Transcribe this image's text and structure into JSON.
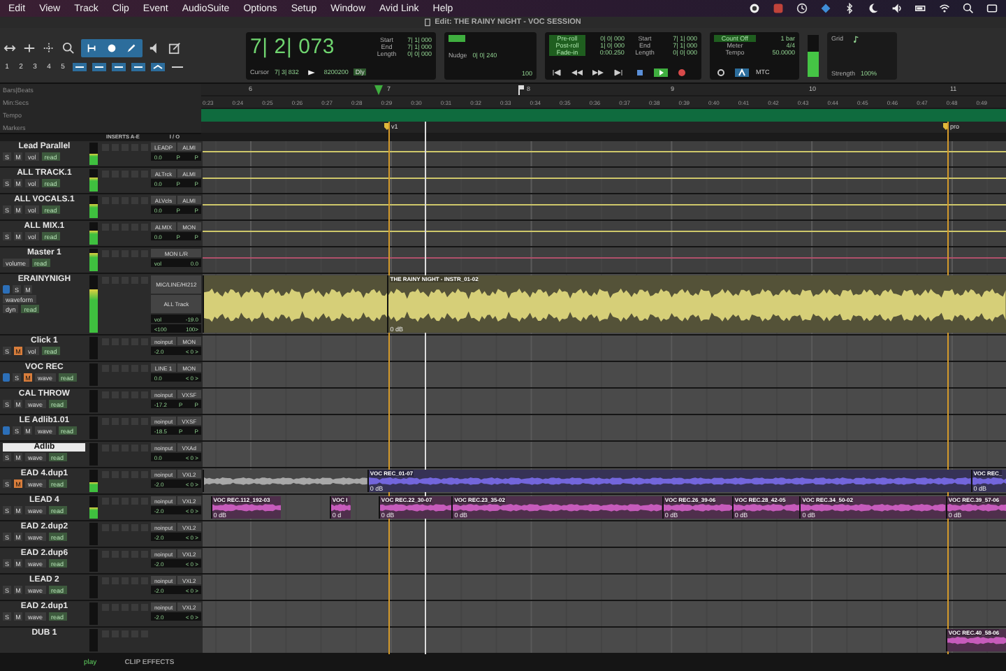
{
  "menu_bar": {
    "items": [
      "Edit",
      "View",
      "Track",
      "Clip",
      "Event",
      "AudioSuite",
      "Options",
      "Setup",
      "Window",
      "Avid Link",
      "Help"
    ]
  },
  "window": {
    "title": "Edit: THE RAINY NIGHT - VOC SESSION"
  },
  "toolbar": {
    "zoom_presets": [
      "1",
      "2",
      "3",
      "4",
      "5"
    ],
    "main_counter": "7| 2| 073",
    "selection": [
      {
        "label": "Start",
        "value": "7| 1| 000"
      },
      {
        "label": "End",
        "value": "7| 1| 000"
      },
      {
        "label": "Length",
        "value": "0| 0| 000"
      }
    ],
    "sub_counter": {
      "label": "Cursor",
      "value": "7| 3| 832",
      "samples": "8200200",
      "delay": "Dly"
    },
    "nudge": {
      "label": "Nudge",
      "value": "0| 0| 240",
      "sub_value": "100"
    },
    "transport": {
      "rows": [
        {
          "label": "Pre-roll",
          "value": "0| 0| 000"
        },
        {
          "label": "Post-roll",
          "value": "1| 0| 000"
        },
        {
          "label": "Fade-in",
          "value": "0:00.250"
        }
      ],
      "selection": [
        {
          "label": "Start",
          "value": "7| 1| 000"
        },
        {
          "label": "End",
          "value": "7| 1| 000"
        },
        {
          "label": "Length",
          "value": "0| 0| 000"
        }
      ]
    },
    "midi": {
      "count_off": "Count Off",
      "count_value": "1 bar",
      "meter_label": "Meter",
      "meter": "4/4",
      "tempo_label": "Tempo",
      "tempo": "50.0000",
      "sync": "MTC"
    },
    "output_meter": {
      "level": 0.6
    },
    "grid": {
      "label": "Grid",
      "strength_label": "Strength",
      "strength": "100%"
    }
  },
  "rulers": {
    "labels": [
      "Bars|Beats",
      "Min:Secs",
      "Tempo",
      "Markers"
    ],
    "bars": [
      "6",
      "7",
      "8",
      "9",
      "10",
      "11"
    ],
    "times": [
      "0:23",
      "0:24",
      "0:25",
      "0:26",
      "0:27",
      "0:28",
      "0:29",
      "0:30",
      "0:31",
      "0:32",
      "0:33",
      "0:34",
      "0:35",
      "0:36",
      "0:37",
      "0:38",
      "0:39",
      "0:40",
      "0:41",
      "0:42",
      "0:43",
      "0:44",
      "0:45",
      "0:46",
      "0:47",
      "0:48",
      "0:49"
    ],
    "markers": [
      "v1",
      "pro"
    ]
  },
  "track_columns": [
    "INSERTS A-E",
    "I / O"
  ],
  "tracks": [
    {
      "name": "Lead Parallel",
      "kind": "aux",
      "buttons": [
        {
          "kind": "solo",
          "label": "S",
          "on": false
        },
        {
          "kind": "mute",
          "label": "M",
          "on": false
        }
      ],
      "view": "vol",
      "automation": "read",
      "meter": {
        "level": 0.5
      },
      "input": "LEADP",
      "output": "ALMI",
      "volume": "0.0",
      "pan": [
        "P",
        "P"
      ]
    },
    {
      "name": "ALL TRACK.1",
      "kind": "aux",
      "buttons": [
        {
          "kind": "solo",
          "label": "S",
          "on": false
        },
        {
          "kind": "mute",
          "label": "M",
          "on": false
        }
      ],
      "view": "vol",
      "automation": "read",
      "meter": {
        "level": 0.6
      },
      "input": "ALTrck",
      "output": "ALMI",
      "volume": "0.0",
      "pan": [
        "P",
        "P"
      ]
    },
    {
      "name": "ALL VOCALS.1",
      "kind": "aux",
      "buttons": [
        {
          "kind": "solo",
          "label": "S",
          "on": false
        },
        {
          "kind": "mute",
          "label": "M",
          "on": false
        }
      ],
      "view": "vol",
      "automation": "read",
      "meter": {
        "level": 0.6
      },
      "input": "ALVcls",
      "output": "ALMI",
      "volume": "0.0",
      "pan": [
        "P",
        "P"
      ]
    },
    {
      "name": "ALL MIX.1",
      "kind": "aux",
      "buttons": [
        {
          "kind": "solo",
          "label": "S",
          "on": false
        },
        {
          "kind": "mute",
          "label": "M",
          "on": false
        }
      ],
      "view": "vol",
      "automation": "read",
      "meter": {
        "level": 0.6
      },
      "input": "ALMIX",
      "output": "MON",
      "volume": "0.0",
      "pan": [
        "P",
        "P"
      ]
    },
    {
      "name": "Master 1",
      "kind": "master",
      "view": "volume",
      "automation": "read",
      "meter": {
        "level": 0.8
      },
      "output": "MON L/R",
      "volume_label": "vol",
      "volume": "0.0"
    },
    {
      "name": "ERAINYNIGH",
      "kind": "instrument",
      "input_monitor": true,
      "buttons": [
        {
          "kind": "solo",
          "label": "S",
          "on": false
        },
        {
          "kind": "mute",
          "label": "M",
          "on": false
        }
      ],
      "view": "waveform",
      "lane": "dyn",
      "automation": "read",
      "meter": {
        "level": 0.75
      },
      "input": "MIC/LINE/HI212",
      "output": "ALL Track",
      "volume_label": "vol",
      "volume": "-19.0",
      "pan": [
        "<100",
        "100>"
      ],
      "clips": [
        {
          "color": "#d6cf78"
        },
        {
          "name": "THE RAINY NIGHT - INSTR_01-02",
          "gain": "0 dB",
          "color": "#d6cf78"
        }
      ]
    },
    {
      "name": "Click 1",
      "kind": "audio",
      "buttons": [
        {
          "kind": "solo",
          "label": "S",
          "on": false
        },
        {
          "kind": "mute",
          "label": "M",
          "on": true
        }
      ],
      "view": "vol",
      "automation": "read",
      "input": "noinput",
      "output": "MON",
      "volume": "-2.0",
      "pan": [
        "< 0 >"
      ]
    },
    {
      "name": "VOC REC",
      "kind": "audio",
      "input_monitor": true,
      "buttons": [
        {
          "kind": "solo",
          "label": "S",
          "on": false
        },
        {
          "kind": "mute",
          "label": "M",
          "on": true
        }
      ],
      "view": "wave",
      "automation": "read",
      "input": "LINE 1",
      "output": "MON",
      "volume": "0.0",
      "pan": [
        "< 0 >"
      ]
    },
    {
      "name": "CAL THROW",
      "kind": "audio",
      "buttons": [
        {
          "kind": "solo",
          "label": "S",
          "on": false
        },
        {
          "kind": "mute",
          "label": "M",
          "on": false
        }
      ],
      "view": "wave",
      "automation": "read",
      "input": "noinput",
      "output": "VXSF",
      "volume": "-17.2",
      "pan": [
        "P",
        "P"
      ]
    },
    {
      "name": "LE Adlib1.01",
      "kind": "audio",
      "input_monitor": true,
      "buttons": [
        {
          "kind": "solo",
          "label": "S",
          "on": false
        },
        {
          "kind": "mute",
          "label": "M",
          "on": false
        }
      ],
      "view": "wave",
      "automation": "read",
      "input": "noinput",
      "output": "VXSF",
      "volume": "-18.5",
      "pan": [
        "P",
        "P"
      ]
    },
    {
      "name": "Adlib",
      "kind": "audio",
      "selected": true,
      "buttons": [
        {
          "kind": "solo",
          "label": "S",
          "on": false
        },
        {
          "kind": "mute",
          "label": "M",
          "on": false
        }
      ],
      "view": "wave",
      "automation": "read",
      "input": "noinput",
      "output": "VXAd",
      "volume": "0.0",
      "pan": [
        "< 0 >"
      ]
    },
    {
      "name": "EAD 4.dup1",
      "kind": "audio",
      "buttons": [
        {
          "kind": "solo",
          "label": "S",
          "on": false
        },
        {
          "kind": "mute",
          "label": "M",
          "on": true
        }
      ],
      "view": "wave",
      "automation": "read",
      "meter": {
        "level": 0.45
      },
      "input": "noinput",
      "output": "VXL2",
      "volume": "-2.0",
      "pan": [
        "< 0 >"
      ],
      "clips": [
        {
          "color": "#a8a8a8"
        },
        {
          "name": "VOC REC_01-07",
          "gain": "0 dB",
          "color": "#7366dc"
        },
        {
          "name": "VOC REC_",
          "gain": "0 dB",
          "color": "#7366dc"
        }
      ]
    },
    {
      "name": "LEAD 4",
      "kind": "audio",
      "buttons": [
        {
          "kind": "solo",
          "label": "S",
          "on": false
        },
        {
          "kind": "mute",
          "label": "M",
          "on": false
        }
      ],
      "view": "wave",
      "automation": "read",
      "meter": {
        "level": 0.5
      },
      "input": "noinput",
      "output": "VXL2",
      "volume": "-2.0",
      "pan": [
        "< 0 >"
      ],
      "clips": [
        {
          "name": "VOC REC.112_192-03",
          "gain": "0 dB",
          "color": "#c65bbb"
        },
        {
          "name": "VOC I",
          "gain": "0 d",
          "color": "#c65bbb"
        },
        {
          "name": "VOC REC.22_30-07",
          "gain": "0 dB",
          "color": "#c65bbb"
        },
        {
          "name": "VOC REC.23_35-02",
          "gain": "0 dB",
          "color": "#c65bbb"
        },
        {
          "name": "VOC REC.26_39-06",
          "gain": "0 dB",
          "color": "#c65bbb"
        },
        {
          "name": "VOC REC.28_42-05",
          "gain": "0 dB",
          "color": "#c65bbb"
        },
        {
          "name": "VOC REC.34_50-02",
          "gain": "0 dB",
          "color": "#c65bbb"
        },
        {
          "name": "VOC REC.39_57-06",
          "gain": "0 dB",
          "color": "#c65bbb"
        }
      ]
    },
    {
      "name": "EAD 2.dup2",
      "kind": "audio",
      "buttons": [
        {
          "kind": "solo",
          "label": "S",
          "on": false
        },
        {
          "kind": "mute",
          "label": "M",
          "on": false
        }
      ],
      "view": "wave",
      "automation": "read",
      "input": "noinput",
      "output": "VXL2",
      "volume": "-2.0",
      "pan": [
        "< 0 >"
      ]
    },
    {
      "name": "EAD 2.dup6",
      "kind": "audio",
      "buttons": [
        {
          "kind": "solo",
          "label": "S",
          "on": false
        },
        {
          "kind": "mute",
          "label": "M",
          "on": false
        }
      ],
      "view": "wave",
      "automation": "read",
      "input": "noinput",
      "output": "VXL2",
      "volume": "-2.0",
      "pan": [
        "< 0 >"
      ]
    },
    {
      "name": "LEAD 2",
      "kind": "audio",
      "buttons": [
        {
          "kind": "solo",
          "label": "S",
          "on": false
        },
        {
          "kind": "mute",
          "label": "M",
          "on": false
        }
      ],
      "view": "wave",
      "automation": "read",
      "input": "noinput",
      "output": "VXL2",
      "volume": "-2.0",
      "pan": [
        "< 0 >"
      ]
    },
    {
      "name": "EAD 2.dup1",
      "kind": "audio",
      "buttons": [
        {
          "kind": "solo",
          "label": "S",
          "on": false
        },
        {
          "kind": "mute",
          "label": "M",
          "on": false
        }
      ],
      "view": "wave",
      "automation": "read",
      "input": "noinput",
      "output": "VXL2",
      "volume": "-2.0",
      "pan": [
        "< 0 >"
      ]
    },
    {
      "name": "DUB 1",
      "kind": "audio",
      "clips": [
        {
          "name": "VOC REC.40_58-06",
          "color": "#c65bbb"
        }
      ]
    }
  ],
  "bottom_bar": {
    "status": "play",
    "tab": "CLIP EFFECTS"
  }
}
